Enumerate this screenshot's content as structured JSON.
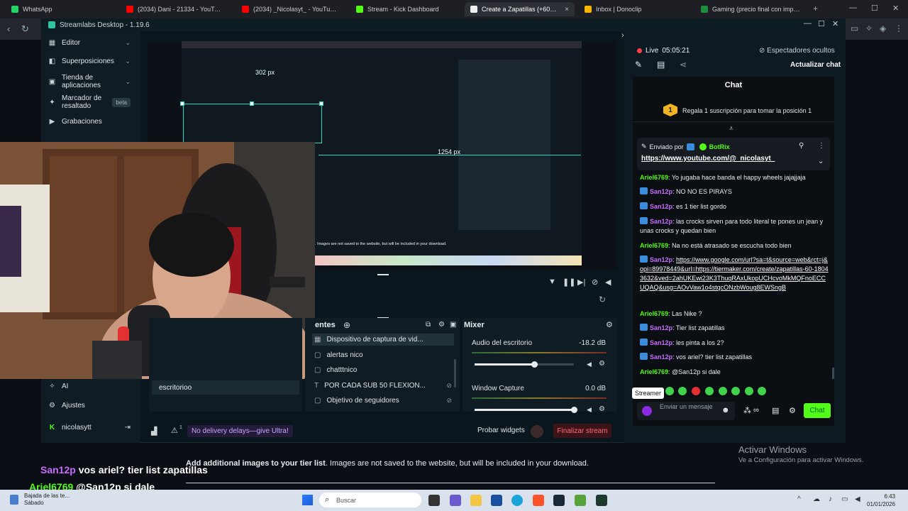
{
  "browser": {
    "tabs": [
      {
        "label": "WhatsApp",
        "color": "#25d366"
      },
      {
        "label": "(2034) Dani - 21334 - YouTube",
        "color": "#ff0000"
      },
      {
        "label": "(2034) _Nicolasyt_ - YouTube",
        "color": "#ff0000"
      },
      {
        "label": "Stream - Kick Dashboard",
        "color": "#53fc18"
      },
      {
        "label": "Create a Zapatillas (+60) Tier Lis",
        "color": "#f0f0f0"
      },
      {
        "label": "Inbox | Donoclip",
        "color": "#f7b500"
      },
      {
        "label": "Gaming (precio final con impuestos)",
        "color": "#1e8e3e"
      }
    ],
    "new_tab": "+",
    "close_tab": "×"
  },
  "streamlabs": {
    "title": "Streamlabs Desktop - 1.19.6",
    "nav": [
      {
        "label": "Editor",
        "icon": "editor-icon"
      },
      {
        "label": "Superposiciones",
        "icon": "overlay-icon"
      },
      {
        "label": "Tienda de aplicaciones",
        "icon": "store-icon"
      },
      {
        "label": "Marcador de resaltado",
        "icon": "highlight-icon",
        "badge": "beta"
      },
      {
        "label": "Grabaciones",
        "icon": "recordings-icon"
      }
    ],
    "nav_bottom": [
      {
        "label": "AI",
        "icon": "ai-icon"
      },
      {
        "label": "Ajustes",
        "icon": "settings-icon"
      },
      {
        "label": "nicolasytt",
        "icon": "kick-icon"
      }
    ],
    "selection_width": "302 px",
    "selection_height": "1254 px",
    "scenes_item": "escritorioo",
    "sources_header": "entes",
    "sources": [
      {
        "label": "Dispositivo de captura de vid...",
        "selected": true
      },
      {
        "label": "alertas nico"
      },
      {
        "label": "chatttnico"
      },
      {
        "label": "POR CADA SUB 50 FLEXION..."
      },
      {
        "label": "Objetivo de seguidores"
      }
    ],
    "mixer": {
      "title": "Mixer",
      "channels": [
        {
          "label": "Audio del escritorio",
          "value": "-18.2 dB",
          "level": 0.6
        },
        {
          "label": "Window Capture",
          "value": "0.0 dB",
          "level": 1.0
        }
      ]
    },
    "ultra_banner": "No delivery delays—give Ultra!",
    "notifications": "1",
    "probar_widgets": "Probar widgets",
    "finalizar": "Finalizar stream"
  },
  "live": {
    "label": "Live",
    "time": "05:05:21",
    "viewers": "Espectadores ocultos",
    "refresh": "Actualizar chat"
  },
  "chat": {
    "title": "Chat",
    "pinned_num": "1",
    "pinned_text": "Regala 1 suscripción para tomar la posición 1",
    "sent_by": "Enviado por",
    "bot": "BotRix",
    "sent_link": "https://www.youtube.com/@_nicolasyt_",
    "messages": [
      {
        "user": "Ariel6769",
        "type": "A",
        "text": ": Yo jugaba hace banda el happy wheels jajajjaja"
      },
      {
        "user": "San12p",
        "type": "S",
        "text": ": NO NO ES PIRAYS"
      },
      {
        "user": "San12p",
        "type": "S",
        "text": ": es 1 tier list gordo"
      },
      {
        "user": "San12p",
        "type": "S",
        "text": ": las crocks sirven para todo literal te pones un jean y unas crocks y quedan bien"
      },
      {
        "user": "Ariel6769",
        "type": "A",
        "text": ": Na no está atrasado se escucha todo bien"
      },
      {
        "user": "San12p",
        "type": "S",
        "text": ": ",
        "link": "https://www.google.com/url?sa=t&source=web&rct=j&opi=89978449&url=https://tiermaker.com/create/zapatillas-60-18043632&ved=2ahUKEwi23K3ThuqRAxUkopUCHcvoMkMQFnoECCUQAQ&usg=AOvVaw1o4stqcONzbWoug8EWSngB"
      },
      {
        "user": "Ariel6769",
        "type": "A",
        "text": ": Las Nike ?"
      },
      {
        "user": "San12p",
        "type": "S",
        "text": ": Tier list zapatillas"
      },
      {
        "user": "San12p",
        "type": "S",
        "text": ": les pinta a los 2?"
      },
      {
        "user": "San12p",
        "type": "S",
        "text": ": vos ariel? tier list zapatillas"
      },
      {
        "user": "Ariel6769",
        "type": "A",
        "text": ": @San12p si dale"
      }
    ],
    "streamer_label": "Streamer",
    "input_placeholder": "Enviar un mensaje",
    "send": "Chat"
  },
  "page": {
    "activar_title": "Activar Windows",
    "activar_sub": "Ve a Configuración para activar Windows.",
    "tier_bold": "Add additional images to your tier list",
    "tier_rest": ". Images are not saved to the website, but will be included in your download.",
    "overlay1_user": "San12p",
    "overlay1_text": "vos ariel? tier list zapatillas",
    "overlay2_user": "Ariel6769",
    "overlay2_text": "@San12p si dale"
  },
  "taskbar": {
    "weather_line1": "Bajada de las te...",
    "weather_line2": "Sábado",
    "search": "Buscar",
    "time": "6:43",
    "date": "01/01/2026"
  }
}
